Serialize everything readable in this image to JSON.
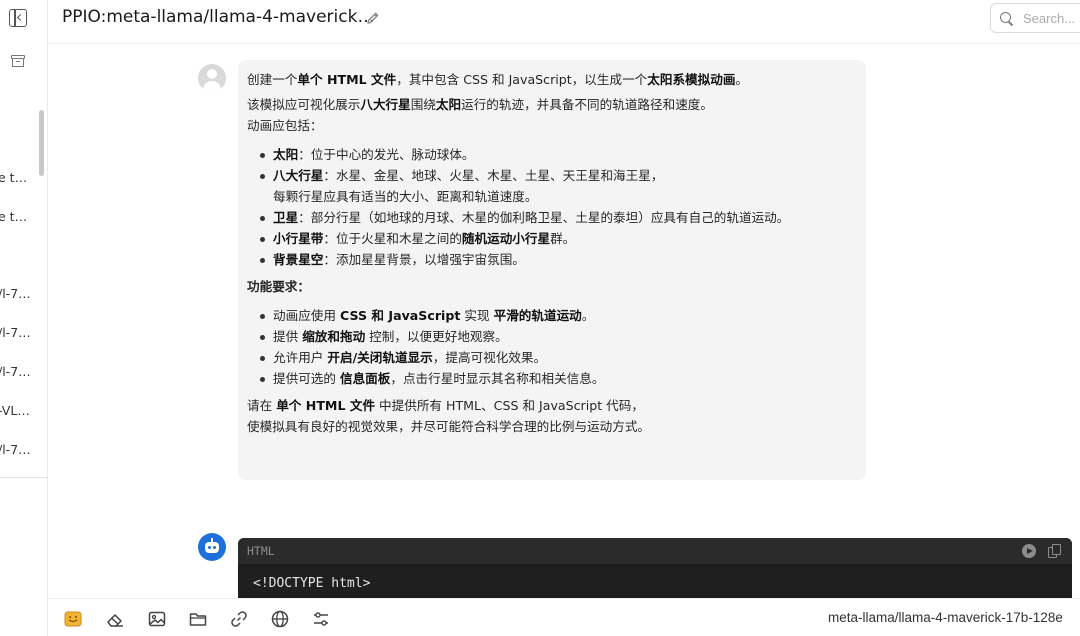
{
  "sidebar": {
    "items": [
      {
        "label": "e t…"
      },
      {
        "label": "e t…"
      },
      {
        "label": "/l-7…"
      },
      {
        "label": "/l-7…"
      },
      {
        "label": "/l-7…"
      },
      {
        "label": "-VL…"
      },
      {
        "label": "/l-7…"
      }
    ]
  },
  "header": {
    "title": "PPIO:meta-llama/llama-4-maverick…",
    "search_placeholder": "Search..."
  },
  "user_message": {
    "p1": [
      {
        "t": "创建一个"
      },
      {
        "t": "单个 HTML 文件",
        "b": true
      },
      {
        "t": "，其中包含 CSS 和 JavaScript，以生成一个"
      },
      {
        "t": "太阳系模拟动画",
        "b": true
      },
      {
        "t": "。"
      }
    ],
    "p2": [
      {
        "t": "该模拟应可视化展示"
      },
      {
        "t": "八大行星",
        "b": true
      },
      {
        "t": "围绕"
      },
      {
        "t": "太阳",
        "b": true
      },
      {
        "t": "运行的轨迹，并具备不同的轨道路径和速度。"
      }
    ],
    "p3": "动画应包括：",
    "list1": [
      [
        {
          "t": "太阳",
          "b": true
        },
        {
          "t": "：位于中心的发光、脉动球体。"
        }
      ],
      [
        {
          "t": "八大行星",
          "b": true
        },
        {
          "t": "：水星、金星、地球、火星、木星、土星、天王星和海王星，"
        }
      ],
      [
        {
          "t": "卫星",
          "b": true
        },
        {
          "t": "：部分行星（如地球的月球、木星的伽利略卫星、土星的泰坦）应具有自己的轨道运动。"
        }
      ],
      [
        {
          "t": "小行星带",
          "b": true
        },
        {
          "t": "：位于火星和木星之间的"
        },
        {
          "t": "随机运动小行星",
          "b": true
        },
        {
          "t": "群。"
        }
      ],
      [
        {
          "t": "背景星空",
          "b": true
        },
        {
          "t": "：添加星星背景，以增强宇宙氛围。"
        }
      ]
    ],
    "list1_continuation": "每颗行星应具有适当的大小、距离和轨道速度。",
    "section_title": "功能要求：",
    "list2": [
      [
        {
          "t": "动画应使用 "
        },
        {
          "t": "CSS 和 JavaScript",
          "b": true
        },
        {
          "t": " 实现 "
        },
        {
          "t": "平滑的轨道运动",
          "b": true
        },
        {
          "t": "。"
        }
      ],
      [
        {
          "t": "提供 "
        },
        {
          "t": "缩放和拖动",
          "b": true
        },
        {
          "t": " 控制，以便更好地观察。"
        }
      ],
      [
        {
          "t": "允许用户 "
        },
        {
          "t": "开启/关闭轨道显示",
          "b": true
        },
        {
          "t": "，提高可视化效果。"
        }
      ],
      [
        {
          "t": "提供可选的 "
        },
        {
          "t": "信息面板",
          "b": true
        },
        {
          "t": "，点击行星时显示其名称和相关信息。"
        }
      ]
    ],
    "closing_line1": [
      {
        "t": "请在 "
      },
      {
        "t": "单个 HTML 文件",
        "b": true
      },
      {
        "t": " 中提供所有 HTML、CSS 和 JavaScript 代码，"
      }
    ],
    "closing_line2": "使模拟具有良好的视觉效果，并尽可能符合科学合理的比例与运动方式。"
  },
  "assistant_message": {
    "code_language": "HTML",
    "code_first_line": "<!DOCTYPE html>"
  },
  "footer": {
    "tools": [
      "emoji-icon",
      "eraser-icon",
      "image-icon",
      "folder-icon",
      "link-icon",
      "globe-icon",
      "settings-sliders-icon"
    ],
    "model_label": "meta-llama/llama-4-maverick-17b-128e"
  },
  "colors": {
    "bubble_bg": "#f4f4f4",
    "bot_avatar": "#1e6fd9",
    "code_bg": "#1f1f1f"
  }
}
